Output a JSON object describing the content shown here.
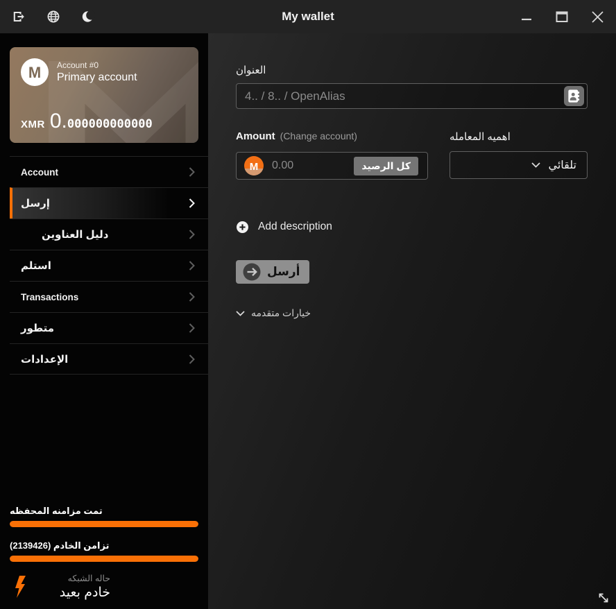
{
  "colors": {
    "accent": "#f97006",
    "monero_orange": "#f26f15",
    "titlebar_bg": "#232323",
    "sidebar_bg": "#040404",
    "card_gradient_from": "#94795f",
    "card_gradient_to": "#51473e",
    "send_button_bg": "#8f8f8f"
  },
  "titlebar": {
    "title": "My wallet",
    "icons": [
      "logout-icon",
      "globe-icon",
      "moon-icon"
    ],
    "window_controls": [
      "minimize",
      "maximize",
      "close"
    ]
  },
  "sidebar": {
    "account_card": {
      "account_index_label": "Account #0",
      "account_name": "Primary account",
      "currency": "XMR",
      "balance_int": "0.",
      "balance_frac": "000000000000"
    },
    "menu": [
      {
        "label": "Account",
        "active": false,
        "sub": false
      },
      {
        "label": "إرسل",
        "active": true,
        "sub": false
      },
      {
        "label": "دليل العناوين",
        "active": false,
        "sub": true
      },
      {
        "label": "استلم",
        "active": false,
        "sub": false
      },
      {
        "label": "Transactions",
        "active": false,
        "sub": false
      },
      {
        "label": "متطور",
        "active": false,
        "sub": false
      },
      {
        "label": "الإعدادات",
        "active": false,
        "sub": false
      }
    ],
    "status": {
      "wallet_sync_label": "تمت مزامنه المحفظه",
      "wallet_sync_progress": 100,
      "daemon_sync_label": "تزامن الخادم (2139426)",
      "daemon_sync_progress": 100,
      "network_status_title": "حاله الشبكه",
      "network_status_value": "خادم بعيد"
    }
  },
  "main": {
    "address": {
      "label": "العنوان",
      "placeholder": "4.. / 8.. / OpenAlias"
    },
    "amount": {
      "label": "Amount",
      "change_account_label": "(Change account)",
      "placeholder": "0.00",
      "all_balance_label": "كل الرصيد"
    },
    "priority": {
      "label": "اهميه المعامله",
      "selected": "تلقائي"
    },
    "add_description_label": "Add description",
    "send_label": "أرسل",
    "advanced_options_label": "خيارات متقدمه"
  }
}
